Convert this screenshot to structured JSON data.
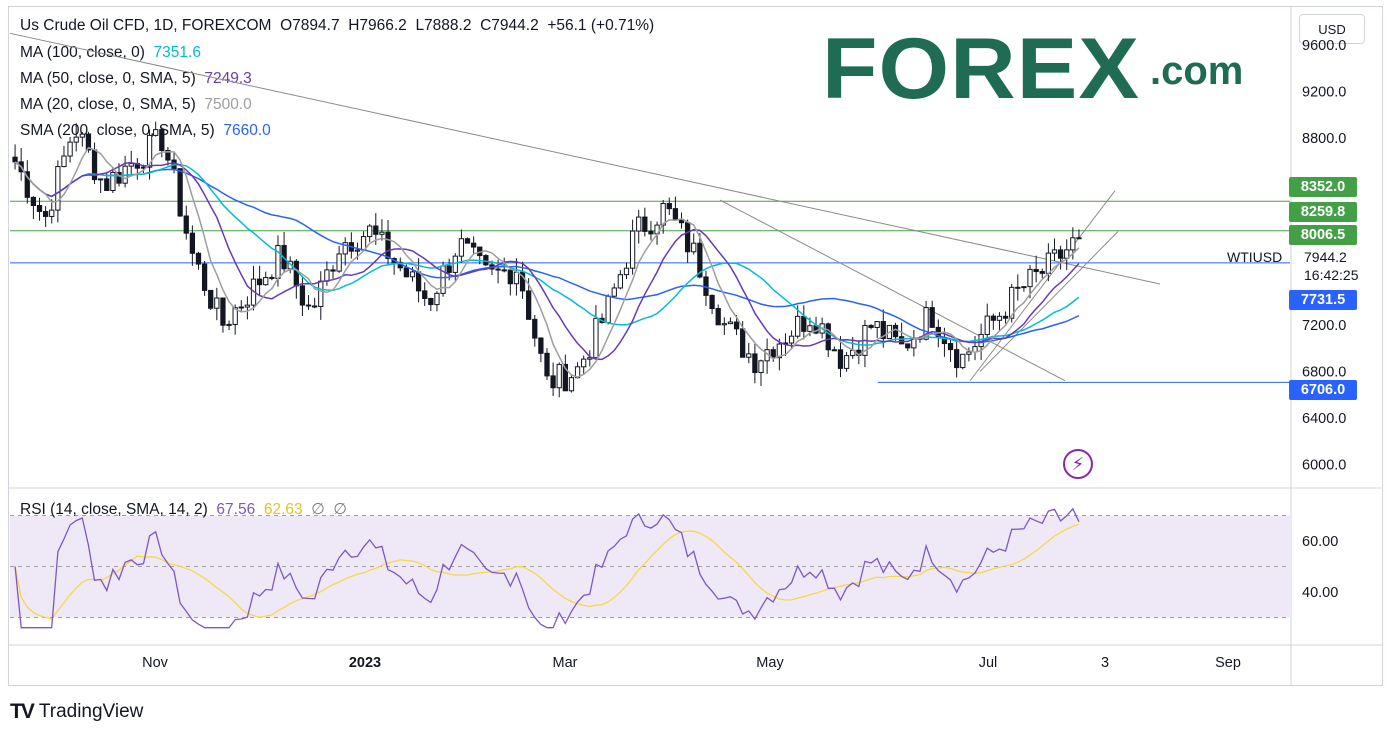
{
  "header": {
    "symbol": "Us Crude Oil CFD, 1D, FOREXCOM",
    "open": "O7894.7",
    "high": "H7966.2",
    "low": "L7888.2",
    "close": "C7944.2",
    "change": "+56.1 (+0.71%)"
  },
  "indicators": [
    {
      "label": "MA (100, close, 0)",
      "value": "7351.6",
      "color": "#00bcd4"
    },
    {
      "label": "MA (50, close, 0, SMA, 5)",
      "value": "7249.3",
      "color": "#673ab7"
    },
    {
      "label": "MA (20, close, 0, SMA, 5)",
      "value": "7500.0",
      "color": "#9e9e9e"
    },
    {
      "label": "SMA (200, close, 0, SMA, 5)",
      "value": "7660.0",
      "color": "#2962ff"
    }
  ],
  "currency": "USD",
  "logo": {
    "main": "FOREX",
    "suffix": ".com",
    "color": "#1f6b54",
    "accent": "#2ecc71"
  },
  "price_axis": [
    "9600.0",
    "9200.0",
    "8800.0",
    "7200.0",
    "6800.0",
    "6400.0",
    "6000.0"
  ],
  "price_badges": [
    {
      "text": "8352.0",
      "color": "#43a047"
    },
    {
      "text": "8259.8",
      "color": "#43a047"
    },
    {
      "text": "8006.5",
      "color": "#43a047"
    },
    {
      "text": "7731.5",
      "color": "#2962ff"
    },
    {
      "text": "6706.0",
      "color": "#2962ff"
    }
  ],
  "last_price": {
    "symbol": "WTIUSD",
    "price": "7944.2",
    "countdown": "16:42:25"
  },
  "rsi": {
    "label": "RSI (14, close, SMA, 14, 2)",
    "value": "67.56",
    "signal": "62.63",
    "extra1": "∅",
    "extra2": "∅",
    "axis": [
      "60.00",
      "40.00"
    ],
    "color": "#7e57c2",
    "signal_color": "#f5d84a"
  },
  "time_axis": [
    "Nov",
    "2023",
    "Mar",
    "May",
    "Jul",
    "3",
    "Sep"
  ],
  "branding": "TradingView",
  "chart_data": {
    "type": "candlestick",
    "title": "Us Crude Oil CFD, 1D, FOREXCOM",
    "ylim": [
      5800,
      9900
    ],
    "horizontal_levels": [
      8352.0,
      8259.8,
      8006.5,
      7731.5,
      6706.0
    ],
    "series": [
      {
        "name": "MA (100, close, 0)",
        "last": 7351.6
      },
      {
        "name": "MA (50, close, 0, SMA, 5)",
        "last": 7249.3
      },
      {
        "name": "MA (20, close, 0, SMA, 5)",
        "last": 7500.0
      },
      {
        "name": "SMA (200, close, 0, SMA, 5)",
        "last": 7660.0
      }
    ],
    "close_points": [
      [
        "Oct",
        8600
      ],
      [
        "Oct",
        8100
      ],
      [
        "Nov",
        8900
      ],
      [
        "Nov",
        8400
      ],
      [
        "Nov",
        8600
      ],
      [
        "Nov",
        8800
      ],
      [
        "Dec",
        7800
      ],
      [
        "Dec",
        7200
      ],
      [
        "Dec",
        7500
      ],
      [
        "2023",
        7800
      ],
      [
        "Jan",
        7300
      ],
      [
        "Jan",
        7900
      ],
      [
        "Jan",
        8000
      ],
      [
        "Feb",
        7700
      ],
      [
        "Feb",
        7400
      ],
      [
        "Feb",
        7900
      ],
      [
        "Feb",
        7600
      ],
      [
        "Mar",
        7700
      ],
      [
        "Mar",
        6700
      ],
      [
        "Mar",
        6800
      ],
      [
        "Mar",
        7300
      ],
      [
        "Apr",
        8000
      ],
      [
        "Apr",
        8200
      ],
      [
        "Apr",
        7800
      ],
      [
        "May",
        7200
      ],
      [
        "May",
        6900
      ],
      [
        "May",
        7100
      ],
      [
        "May",
        7300
      ],
      [
        "Jun",
        6900
      ],
      [
        "Jun",
        7200
      ],
      [
        "Jun",
        7000
      ],
      [
        "Jun",
        7300
      ],
      [
        "Jul",
        6900
      ],
      [
        "Jul",
        7200
      ],
      [
        "Jul",
        7500
      ],
      [
        "Jul",
        7700
      ],
      [
        "Jul",
        7944.2
      ]
    ]
  }
}
